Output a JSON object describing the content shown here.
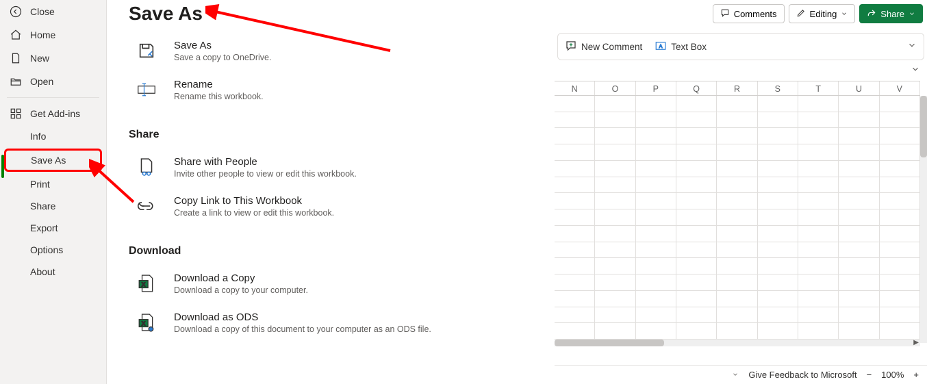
{
  "sidebar": {
    "close": "Close",
    "home": "Home",
    "new": "New",
    "open": "Open",
    "addins": "Get Add-ins",
    "info": "Info",
    "saveas": "Save As",
    "print": "Print",
    "share": "Share",
    "export": "Export",
    "options": "Options",
    "about": "About"
  },
  "page": {
    "title": "Save As",
    "share_heading": "Share",
    "download_heading": "Download"
  },
  "opts": {
    "saveas": {
      "title": "Save As",
      "sub": "Save a copy to OneDrive."
    },
    "rename": {
      "title": "Rename",
      "sub": "Rename this workbook."
    },
    "sharePeople": {
      "title": "Share with People",
      "sub": "Invite other people to view or edit this workbook."
    },
    "copyLink": {
      "title": "Copy Link to This Workbook",
      "sub": "Create a link to view or edit this workbook."
    },
    "dlCopy": {
      "title": "Download a Copy",
      "sub": "Download a copy to your computer."
    },
    "dlOds": {
      "title": "Download as ODS",
      "sub": "Download a copy of this document to your computer as an ODS file."
    }
  },
  "topbar": {
    "comments": "Comments",
    "editing": "Editing",
    "share": "Share"
  },
  "ribbon": {
    "newComment": "New Comment",
    "textBox": "Text Box"
  },
  "columns": [
    "N",
    "O",
    "P",
    "Q",
    "R",
    "S",
    "T",
    "U",
    "V"
  ],
  "status": {
    "feedback": "Give Feedback to Microsoft",
    "zoom": "100%"
  }
}
